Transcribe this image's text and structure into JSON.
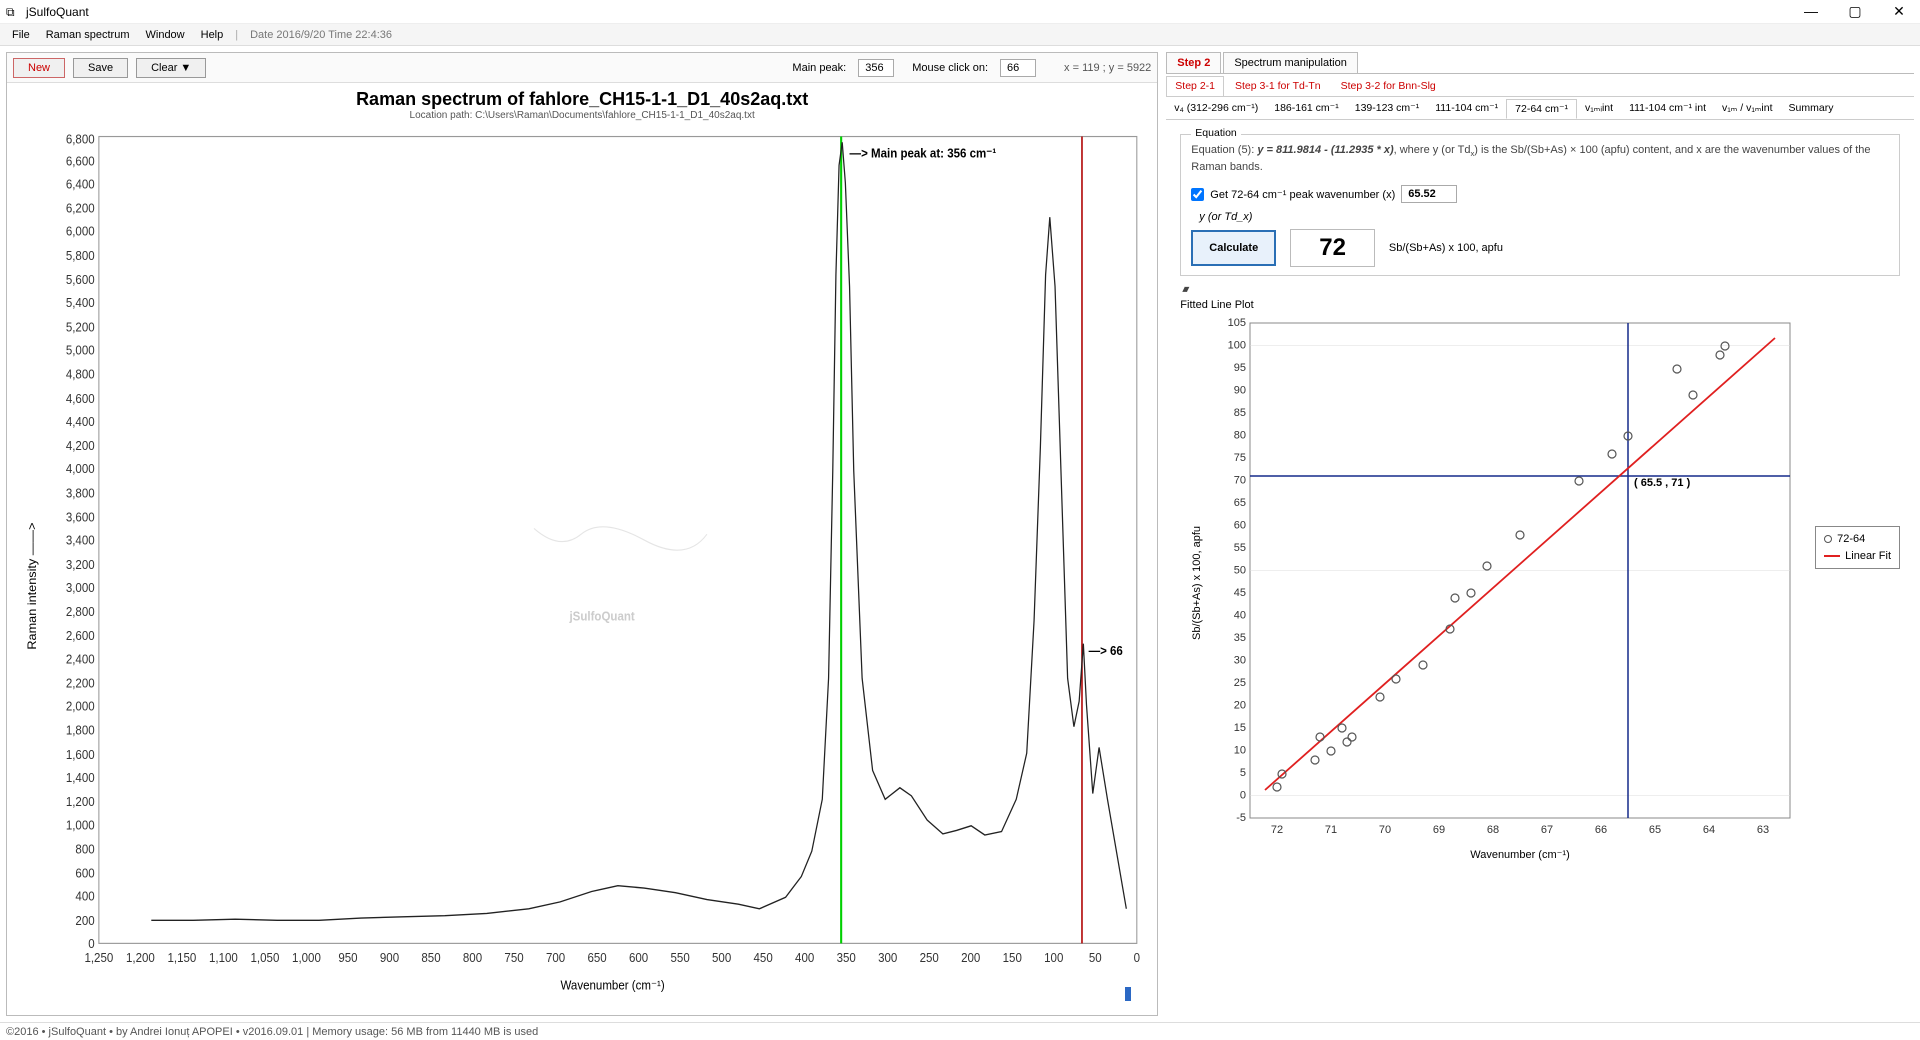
{
  "app": {
    "title": "jSulfoQuant"
  },
  "menu": {
    "file": "File",
    "raman_spectrum": "Raman spectrum",
    "window": "Window",
    "help": "Help",
    "datetime": "Date 2016/9/20   Time 22:4:36"
  },
  "winbtns": {
    "min": "—",
    "max": "▢",
    "close": "✕"
  },
  "toolbar": {
    "new": "New",
    "save": "Save",
    "clear": "Clear ▼",
    "main_peak_label": "Main peak:",
    "main_peak_value": "356",
    "click_label": "Mouse click on:",
    "click_value": "66",
    "xy": "x = 119 ; y = 5922"
  },
  "chart": {
    "title": "Raman spectrum of fahlore_CH15-1-1_D1_40s2aq.txt",
    "subtitle": "Location path: C:\\Users\\Raman\\Documents\\fahlore_CH15-1-1_D1_40s2aq.txt",
    "ylabel": "Raman intensity ——>",
    "xlabel": "Wavenumber (cm⁻¹)",
    "main_peak_anno": "—> Main peak at: 356 cm⁻¹",
    "click_anno": "—> 66",
    "watermark": "jSulfoQuant"
  },
  "steps": {
    "step2": "Step 2",
    "step2_label": "Spectrum manipulation",
    "sub21": "Step 2-1",
    "sub31": "Step 3-1 for Td-Tn",
    "sub32": "Step 3-2 for Bnn-Slg"
  },
  "bands": {
    "b1": "v₄ (312-296 cm⁻¹)",
    "b2": "186-161 cm⁻¹",
    "b3": "139-123 cm⁻¹",
    "b4": "111-104 cm⁻¹",
    "b5": "72-64 cm⁻¹",
    "b6": "v₁ₘᵢint",
    "b7": "111-104 cm⁻¹ int",
    "b8": "v₁ₘ / v₁ₘint",
    "b9": "Summary"
  },
  "equation": {
    "box_label": "Equation",
    "text_prefix": "Equation (5): ",
    "formula": "y = 811.9814 - (11.2935 * x)",
    "text_middle": ", where y (or Td",
    "text_middle2": ") is the Sb/(Sb+As) × 100 (apfu) content, and x are the wavenumber values of the Raman bands.",
    "checkbox_label": "Get 72-64 cm⁻¹ peak wavenumber (x)",
    "x_value": "65.52",
    "ylabel": "y (or Td_x)",
    "calc": "Calculate",
    "result": "72",
    "result_label": "Sb/(Sb+As) x 100, apfu"
  },
  "fitted": {
    "title": "Fitted Line Plot",
    "yl": "Sb/(Sb+As) x 100, apfu",
    "xl": "Wavenumber (cm⁻¹)",
    "point_label": "( 65.5 , 71 )",
    "legend1": "72-64",
    "legend2": "Linear Fit"
  },
  "chart_data": [
    {
      "type": "line",
      "title": "Raman spectrum of fahlore_CH15-1-1_D1_40s2aq.txt",
      "xlabel": "Wavenumber (cm-1)",
      "ylabel": "Raman intensity",
      "xlim": [
        0,
        1250
      ],
      "ylim": [
        0,
        6800
      ],
      "main_peak_x": 356,
      "click_marker_x": 66,
      "second_peak_x": 100,
      "series": [
        {
          "name": "spectrum",
          "note": "single Raman trace; baseline ~200 rising to ~450 over 400-600, sharp peak ~6800 at 356, secondary peak ~6100 at ~100, trough ~1000 near 200, click damped peak at 66 ~= 2200"
        }
      ]
    },
    {
      "type": "scatter",
      "title": "Fitted Line Plot",
      "xlabel": "Wavenumber (cm-1)",
      "ylabel": "Sb/(Sb+As) x 100, apfu",
      "xlim": [
        62.5,
        72.5
      ],
      "ylim": [
        -5,
        105
      ],
      "crosshair": {
        "x": 65.5,
        "y": 71
      },
      "fit_line": {
        "slope": -11.2935,
        "intercept": 811.9814
      },
      "series": [
        {
          "name": "72-64",
          "x": [
            72.0,
            71.9,
            71.3,
            71.2,
            71.0,
            70.8,
            70.7,
            70.6,
            70.1,
            69.8,
            69.3,
            68.8,
            68.7,
            68.4,
            68.1,
            67.5,
            66.4,
            65.8,
            65.5,
            64.6,
            64.3,
            63.8,
            63.7
          ],
          "y": [
            2,
            5,
            8,
            13,
            10,
            15,
            12,
            13,
            22,
            26,
            29,
            37,
            44,
            45,
            51,
            58,
            70,
            76,
            80,
            95,
            89,
            98,
            100
          ]
        }
      ]
    }
  ],
  "status": {
    "text": "©2016 • jSulfoQuant • by Andrei Ionuț APOPEI • v2016.09.01   |   Memory usage: 56 MB from 11440 MB is used"
  }
}
